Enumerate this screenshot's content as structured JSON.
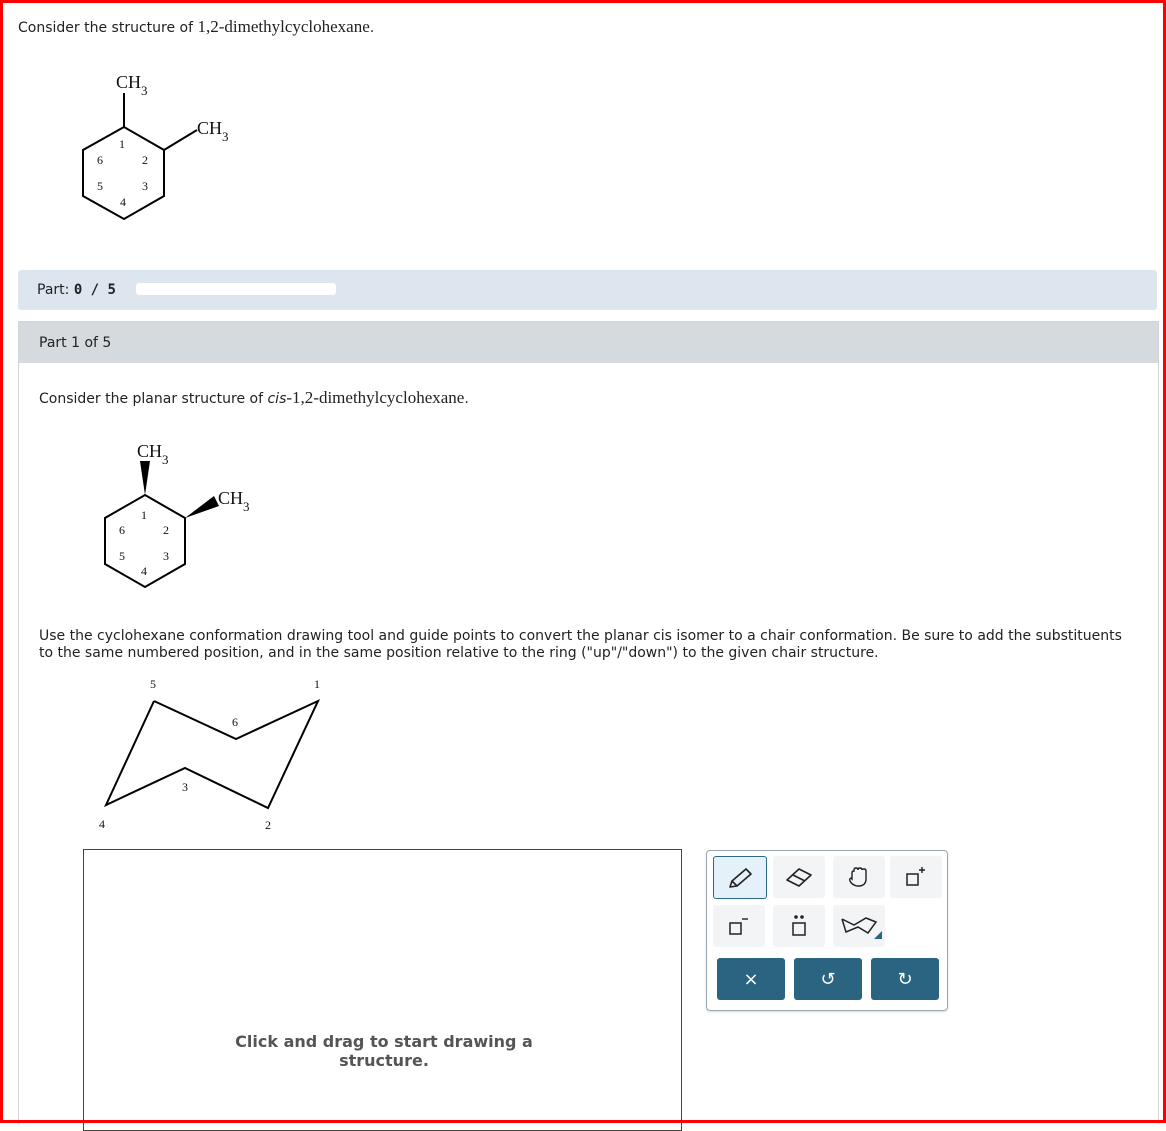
{
  "intro": {
    "prefix": "Consider the structure of ",
    "name": "1,2-dimethylcyclohexane",
    "suffix": "."
  },
  "molecule1": {
    "substituent_top": "CH",
    "substituent_right": "CH",
    "subscript": "3",
    "ring_numbers": [
      "1",
      "2",
      "3",
      "4",
      "5",
      "6"
    ]
  },
  "progress": {
    "label": "Part:",
    "value": "0 / 5",
    "fraction": 0.0
  },
  "part": {
    "header": "Part 1 of 5",
    "question": {
      "prefix": "Consider the planar structure of ",
      "italic": "cis",
      "name": "-1,2-dimethylcyclohexane",
      "suffix": "."
    },
    "molecule2": {
      "substituent_top": "CH",
      "substituent_right": "CH",
      "subscript": "3",
      "ring_numbers": [
        "1",
        "2",
        "3",
        "4",
        "5",
        "6"
      ]
    },
    "instructions": "Use the cyclohexane conformation drawing tool and guide points to convert the planar cis isomer to a chair conformation. Be sure to add the substituents to the same numbered position, and in the same position relative to the ring (\"up\"/\"down\") to the given chair structure.",
    "chair_numbers": [
      "1",
      "2",
      "3",
      "4",
      "5",
      "6"
    ],
    "canvas_hint": "Click and drag to start drawing a structure."
  },
  "toolbar": {
    "tools": [
      "pencil-icon",
      "eraser-icon",
      "hand-icon",
      "add-box-icon",
      "remove-box-icon",
      "lone-pair-icon",
      "chair-template-icon"
    ],
    "actions": {
      "clear": "×",
      "undo": "↺",
      "redo": "↻"
    }
  }
}
